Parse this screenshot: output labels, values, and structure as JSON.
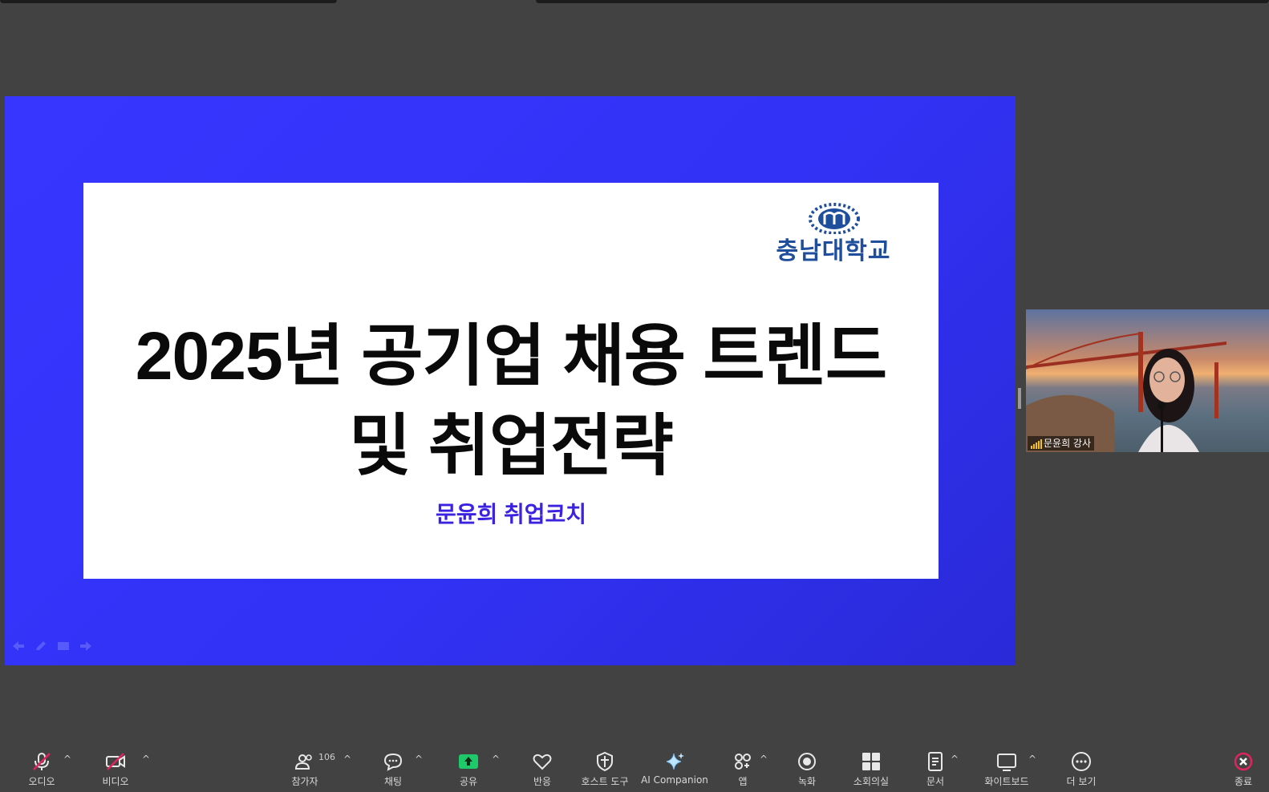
{
  "slide": {
    "university_name": "충남대학교",
    "title_line1": "2025년 공기업 채용 트렌드",
    "title_line2": "및 취업전략",
    "subtitle": "문윤희 취업코치"
  },
  "video": {
    "participant_name": "문윤희 강사"
  },
  "toolbar": {
    "audio_label": "오디오",
    "video_label": "비디오",
    "participants_label": "참가자",
    "participants_count": "106",
    "chat_label": "채팅",
    "share_label": "공유",
    "reactions_label": "반응",
    "host_tools_label": "호스트 도구",
    "ai_companion_label": "AI Companion",
    "apps_label": "앱",
    "record_label": "녹화",
    "breakout_label": "소회의실",
    "docs_label": "문서",
    "whiteboard_label": "화이트보드",
    "more_label": "더 보기",
    "end_label": "종료"
  },
  "colors": {
    "slide_background": "#3636ff",
    "slide_subtitle": "#3b22e0",
    "university_blue": "#1f4f9c",
    "share_green": "#1ec969",
    "end_red": "#e0245e"
  }
}
